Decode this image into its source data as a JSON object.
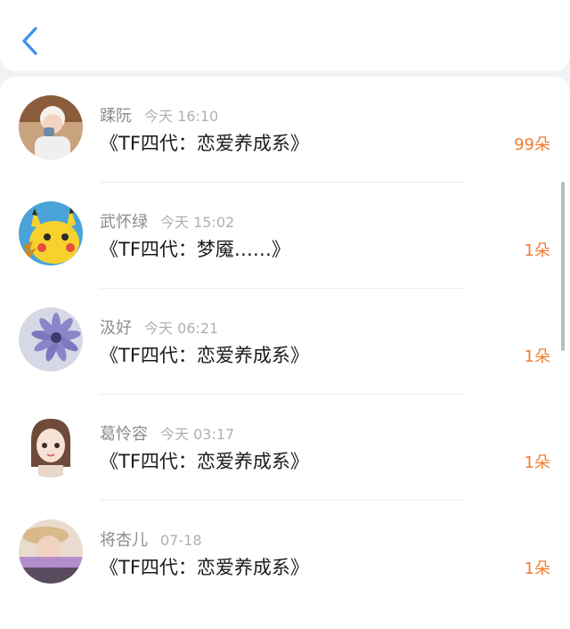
{
  "header": {
    "back_icon": "chevron-left-icon",
    "accent_color": "#3d8ff0"
  },
  "messages": [
    {
      "name": "蹂阮",
      "time": "今天 16:10",
      "title": "《TF四代：恋爱养成系》",
      "count": "99朵",
      "avatar": "girl-photo-avatar"
    },
    {
      "name": "武怀绿",
      "time": "今天 15:02",
      "title": "《TF四代：梦魇……》",
      "count": "1朵",
      "avatar": "pikachu-avatar"
    },
    {
      "name": "汲好",
      "time": "今天 06:21",
      "title": "《TF四代：恋爱养成系》",
      "count": "1朵",
      "avatar": "purple-flower-avatar"
    },
    {
      "name": "葛怜容",
      "time": "今天 03:17",
      "title": "《TF四代：恋爱养成系》",
      "count": "1朵",
      "avatar": "illustrated-girl-avatar"
    },
    {
      "name": "将杏儿",
      "time": "07-18",
      "title": "《TF四代：恋爱养成系》",
      "count": "1朵",
      "avatar": "hat-girl-avatar"
    }
  ],
  "colors": {
    "count": "#f27c2f",
    "name": "#8c8c8c",
    "time": "#b0b0b0",
    "title": "#1a1a1a"
  }
}
